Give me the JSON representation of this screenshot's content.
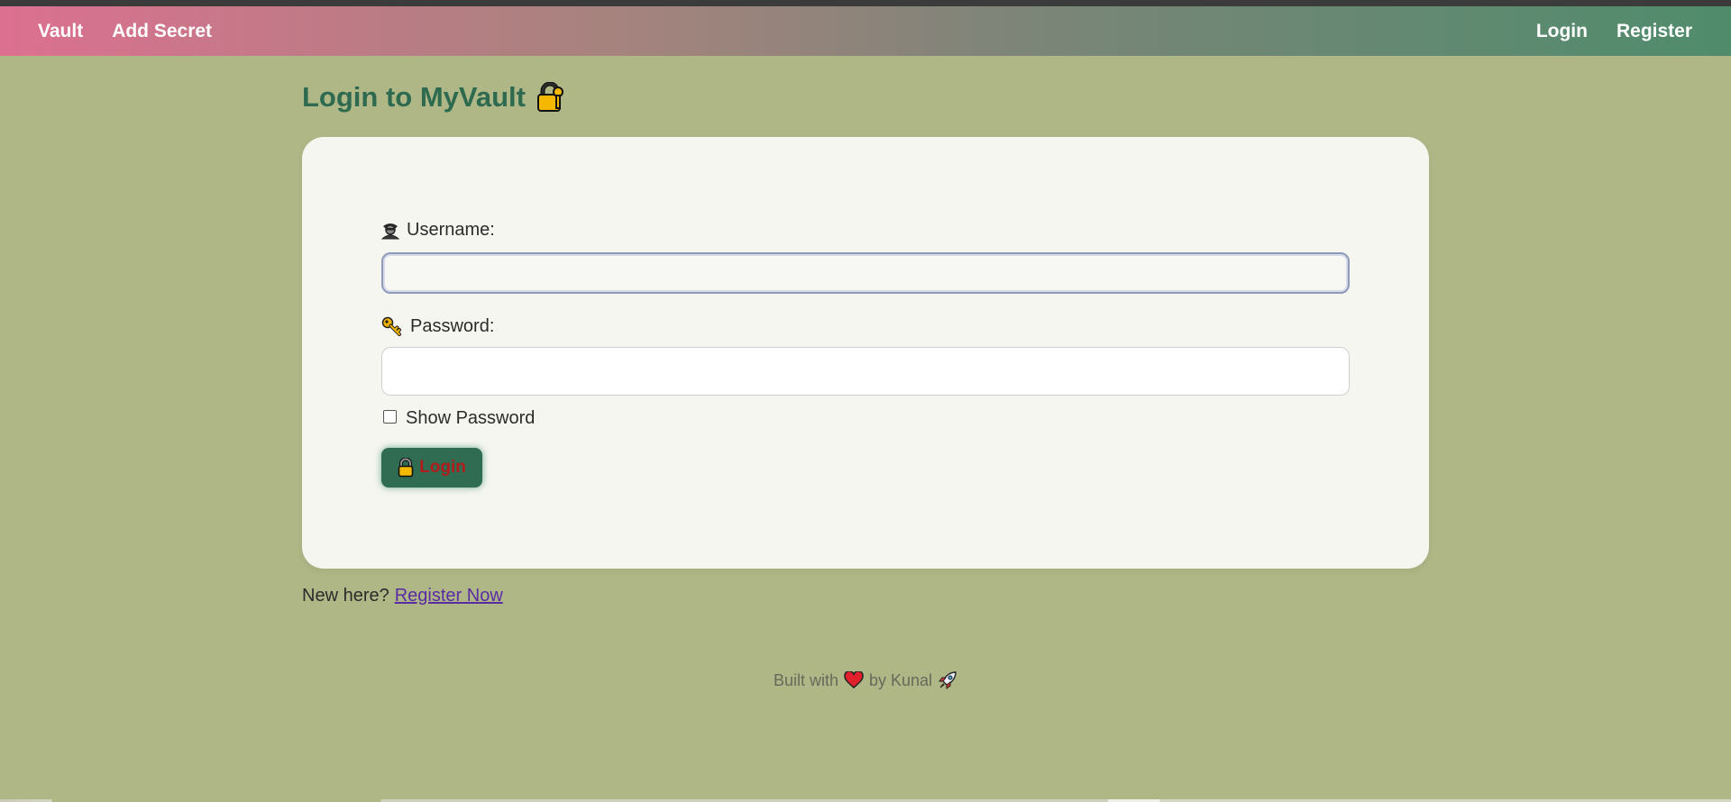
{
  "nav": {
    "brand_label": "Vault",
    "add_secret_label": "Add Secret",
    "login_label": "Login",
    "register_label": "Register"
  },
  "page": {
    "title": "Login to MyVault"
  },
  "form": {
    "username_label": "Username:",
    "username_value": "",
    "password_label": "Password:",
    "password_value": "",
    "show_password_label": "Show Password",
    "show_password_checked": false,
    "submit_label": "Login"
  },
  "register_prompt": {
    "text": "New here?",
    "link_label": "Register Now"
  },
  "footer": {
    "prefix": "Built with",
    "suffix": "by Kunal"
  },
  "colors": {
    "background": "#afb787",
    "title": "#2e6a4f",
    "card": "#f6f6f1",
    "button_bg": "#2f6c52",
    "button_text": "#b11c1c",
    "link": "#5a2ca3",
    "nav_gradient_start": "#dc7090",
    "nav_gradient_end": "#4f8c6c"
  },
  "icons": {
    "title_icon": "locked-with-key-icon",
    "username_icon": "spy-person-icon",
    "password_icon": "key-icon",
    "submit_icon": "lock-icon",
    "footer_heart_icon": "heart-icon",
    "footer_rocket_icon": "rocket-icon"
  }
}
